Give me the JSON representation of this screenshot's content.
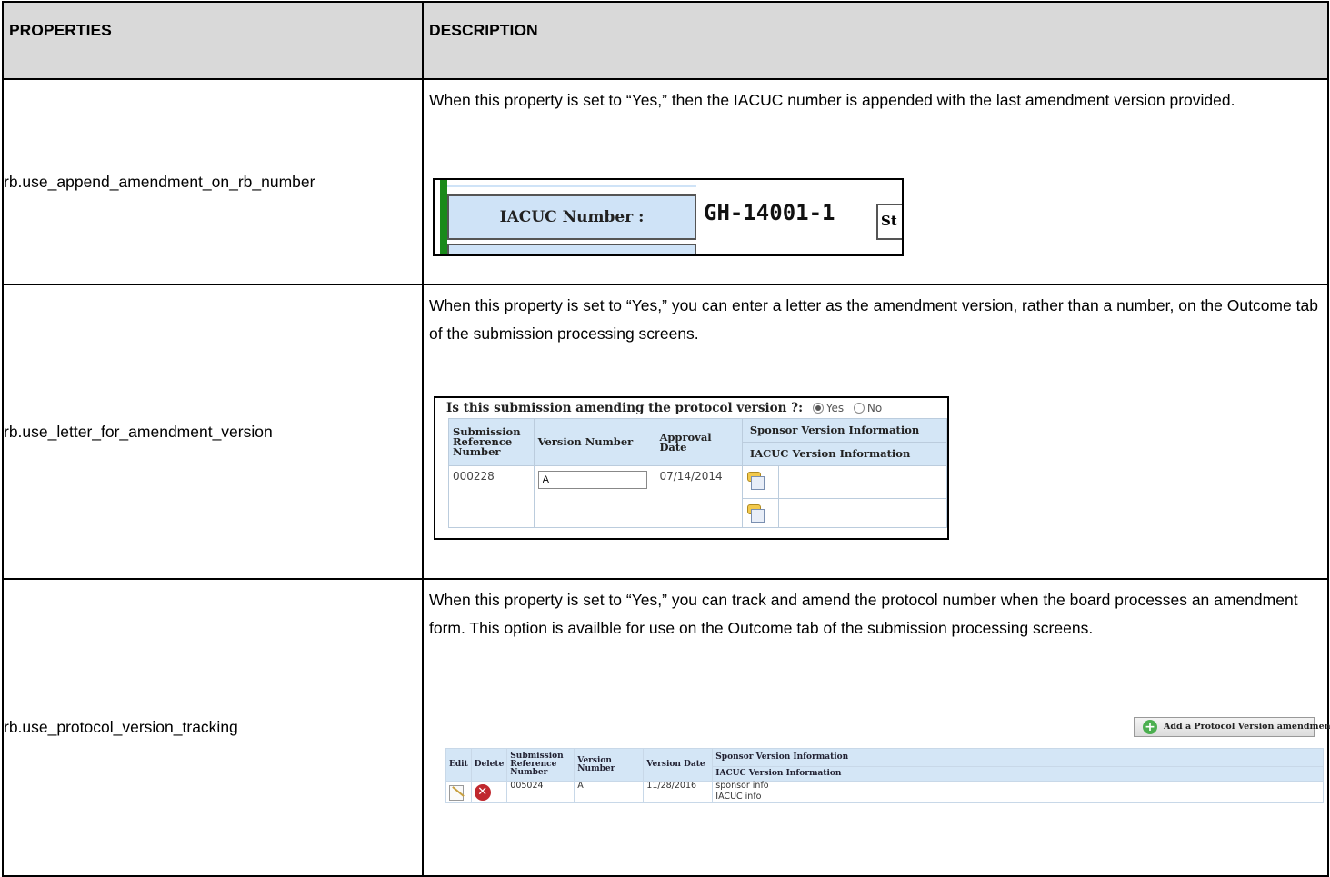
{
  "header": {
    "col1": "PROPERTIES",
    "col2": "DESCRIPTION"
  },
  "rows": [
    {
      "property": "rb.use_append_amendment_on_rb_number",
      "description": "When this property is set to “Yes,” then the IACUC number is appended with the last amendment version provided.",
      "screenshot": {
        "label": "IACUC Number :",
        "value": "GH-14001-1",
        "clipped_label": "St"
      }
    },
    {
      "property": "rb.use_letter_for_amendment_version",
      "description": "When this property is set to “Yes,” you can enter a letter as the amendment version, rather than a number, on the Outcome tab of the submission processing screens.",
      "screenshot": {
        "question": "Is this submission amending the protocol version ?:",
        "radio_yes": "Yes",
        "radio_no": "No",
        "selected": "Yes",
        "headers": [
          "Submission Reference Number",
          "Version Number",
          "Approval Date",
          "Sponsor Version Information",
          "IACUC Version Information"
        ],
        "row": {
          "submission_ref": "000228",
          "version": "A",
          "approval_date": "07/14/2014"
        },
        "icon": "note-icon"
      }
    },
    {
      "property": "rb.use_protocol_version_tracking",
      "description": "When this property is set to “Yes,” you can track and amend the protocol number when the board processes an amendment form. This option is availble for use on the Outcome tab of the submission processing screens.",
      "screenshot": {
        "add_button": "Add a Protocol Version amendment",
        "headers": [
          "Edit",
          "Delete",
          "Submission Reference Number",
          "Version Number",
          "Version Date",
          "Sponsor Version Information",
          "IACUC Version Information"
        ],
        "row": {
          "submission_ref": "005024",
          "version": "A",
          "version_date": "11/28/2016",
          "sponsor_info": "sponsor info",
          "iacuc_info": "IACUC info"
        },
        "edit_icon": "edit-icon",
        "delete_icon": "delete-icon"
      }
    }
  ],
  "colors": {
    "header_bg": "#d9d9d9",
    "grid_header_bg": "#d4e6f6",
    "green_bar": "#1a8a1a",
    "delete_red": "#c0282e"
  }
}
